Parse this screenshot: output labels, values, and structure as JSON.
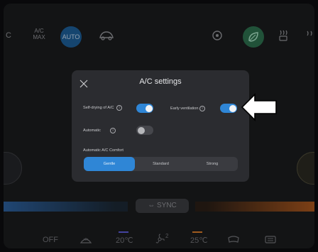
{
  "topbar": {
    "c": "C",
    "acmax": "A/C MAX",
    "auto": "AUTO"
  },
  "sync": {
    "label": "⇔ SYNC"
  },
  "bottom": {
    "off": "OFF",
    "temp_left": "20℃",
    "fan": "2",
    "temp_right": "25℃"
  },
  "modal": {
    "title": "A/C settings",
    "self_drying_label": "Self-drying of A/C",
    "early_vent_label": "Early ventilation",
    "automatic_label": "Automatic",
    "comfort_label": "Automatic A/C Comfort",
    "options": [
      "Gentle",
      "Standard",
      "Strong"
    ],
    "selected": "Gentle",
    "toggles": {
      "self_drying": true,
      "early_ventilation": true,
      "automatic": false
    }
  },
  "colors": {
    "accent": "#2f86d6",
    "panel": "#2b2c30",
    "background": "#1a1b1d"
  }
}
